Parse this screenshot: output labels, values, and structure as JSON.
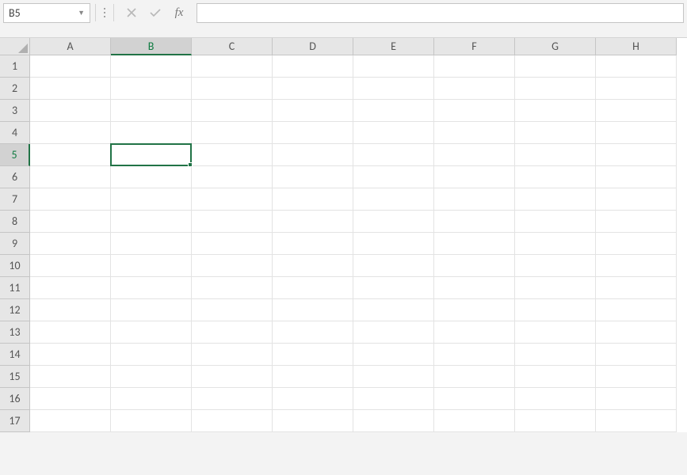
{
  "nameBox": {
    "value": "B5"
  },
  "formulaBar": {
    "value": "",
    "fxLabel": "fx"
  },
  "columns": [
    "A",
    "B",
    "C",
    "D",
    "E",
    "F",
    "G",
    "H"
  ],
  "rows": [
    "1",
    "2",
    "3",
    "4",
    "5",
    "6",
    "7",
    "8",
    "9",
    "10",
    "11",
    "12",
    "13",
    "14",
    "15",
    "16",
    "17"
  ],
  "selection": {
    "col": "B",
    "row": "5",
    "colIndex": 1,
    "rowIndex": 4
  },
  "colors": {
    "accent": "#217346",
    "headerBg": "#e6e6e6",
    "gridLine": "#e3e3e3"
  }
}
